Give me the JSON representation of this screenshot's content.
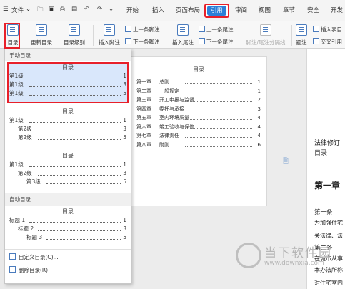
{
  "menubar": {
    "file": "文件",
    "tabs": [
      "开始",
      "插入",
      "页面布局",
      "引用",
      "审阅",
      "视图",
      "章节",
      "安全",
      "开发"
    ],
    "active_tab": "引用",
    "accent": "#2c7fd8",
    "highlight": "#e8202a"
  },
  "ribbon": {
    "toc": "目录",
    "update_toc": "更新目录",
    "toc_level": "目录级别",
    "insert_footnote": "插入脚注",
    "prev_footnote": "上一条脚注",
    "next_footnote": "下一条脚注",
    "insert_endnote": "插入尾注",
    "prev_endnote": "上一条尾注",
    "next_endnote": "下一条尾注",
    "footnote_sep": "脚注/尾注分隔线",
    "caption": "题注",
    "insert_table_toc": "插入表目",
    "cross_ref": "交叉引用"
  },
  "dropdown": {
    "manual_header": "手动目录",
    "auto_header": "自动目录",
    "preview_title": "目录",
    "manual": [
      {
        "t": "第1级",
        "n": "1"
      },
      {
        "t": "第1级",
        "n": "3"
      },
      {
        "t": "第1级",
        "n": "5"
      }
    ],
    "preset2": [
      {
        "t": "第1级",
        "n": "1"
      },
      {
        "t": "第2级",
        "n": "3"
      },
      {
        "t": "第2级",
        "n": "5"
      }
    ],
    "preset3": [
      {
        "t": "第1级",
        "n": "1"
      },
      {
        "t": "第2级",
        "n": "3"
      },
      {
        "t": "第3级",
        "n": "5"
      }
    ],
    "auto": [
      {
        "t": "标题 1",
        "n": "1"
      },
      {
        "t": "标题 2",
        "n": "3"
      },
      {
        "t": "标题 3",
        "n": "5"
      }
    ],
    "custom": "自定义目录(C)...",
    "delete": "删除目录(R)"
  },
  "doc": {
    "toc_title": "目录",
    "chapters": [
      {
        "c": "第一章",
        "t": "总则",
        "n": "1"
      },
      {
        "c": "第二章",
        "t": "一般规定",
        "n": "1"
      },
      {
        "c": "第三章",
        "t": "开工申报与监督",
        "n": "2"
      },
      {
        "c": "第四章",
        "t": "委托与承接",
        "n": "3"
      },
      {
        "c": "第五章",
        "t": "室内环境质量",
        "n": "4"
      },
      {
        "c": "第六章",
        "t": "竣工验收与保修",
        "n": "4"
      },
      {
        "c": "第七章",
        "t": "法律责任",
        "n": "4"
      },
      {
        "c": "第八章",
        "t": "附则",
        "n": "6"
      }
    ],
    "p2_law": "法律修订",
    "p2_toc": "目录",
    "p2_chapter": "第一章",
    "p2_article": "第一条",
    "p2_line1": "为加强住宅",
    "p2_line2": "关法律、法",
    "p2_line3": "第二条",
    "p2_line4": "在城市从事",
    "p2_line5": "本办法所称",
    "p2_line6": "对住宅室内"
  },
  "watermark": {
    "name": "当下软件园",
    "url": "www.downxia.com"
  }
}
